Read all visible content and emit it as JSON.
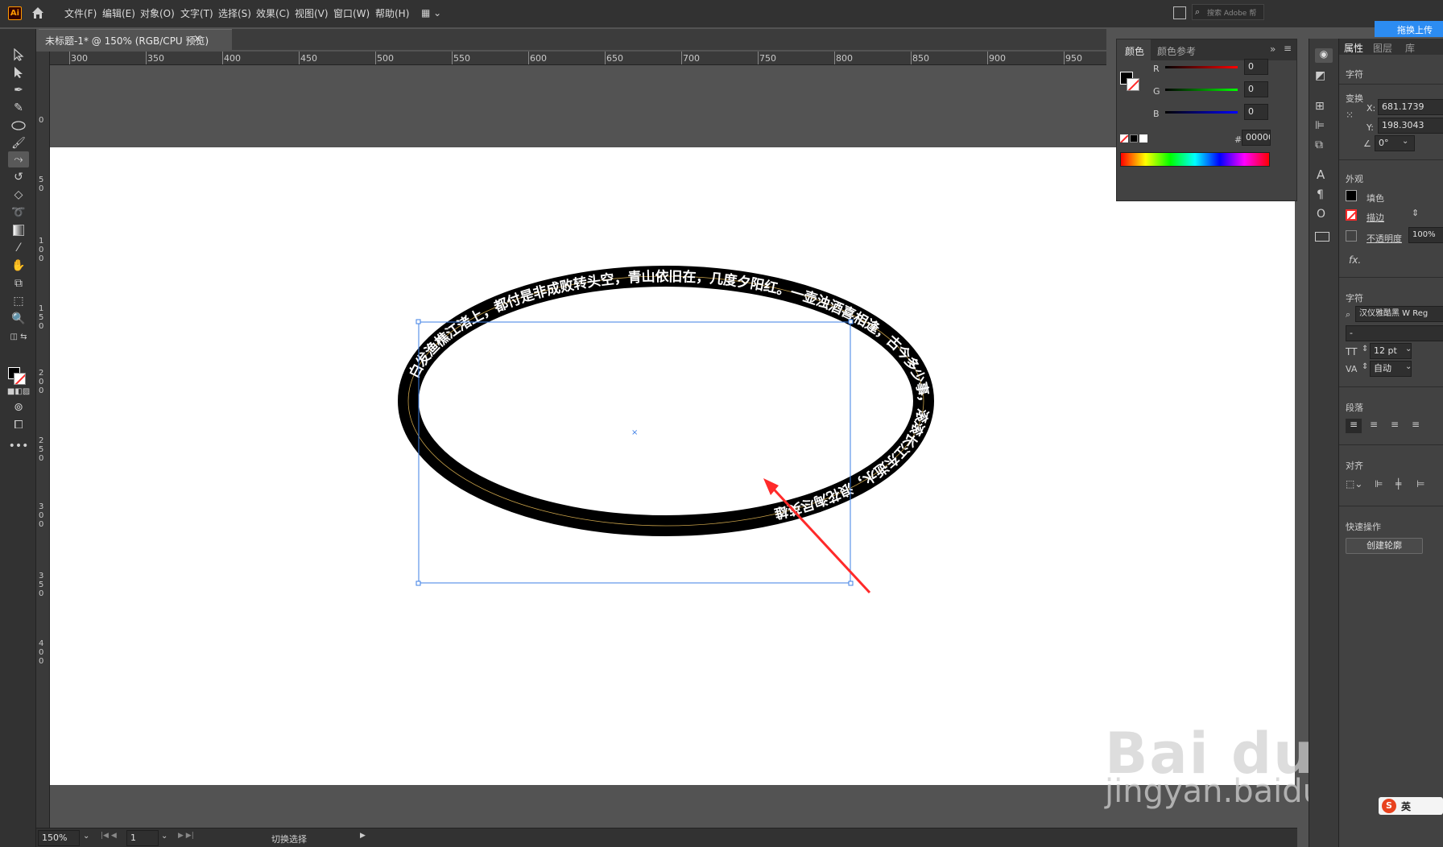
{
  "app": {
    "logo": "Ai",
    "home_icon": "home-icon"
  },
  "menu": [
    "文件(F)",
    "编辑(E)",
    "对象(O)",
    "文字(T)",
    "选择(S)",
    "效果(C)",
    "视图(V)",
    "窗口(W)",
    "帮助(H)"
  ],
  "search": {
    "placeholder": "搜索 Adobe 帮"
  },
  "document": {
    "tab_title": "未标题-1* @ 150% (RGB/CPU 预览)",
    "close": "×"
  },
  "ruler_top": [
    "300",
    "350",
    "400",
    "450",
    "500",
    "550",
    "600",
    "650",
    "700",
    "750",
    "800",
    "850",
    "900",
    "950"
  ],
  "ruler_left": [
    "0",
    "5\n0",
    "1\n0\n0",
    "1\n5\n0",
    "2\n0\n0",
    "2\n5\n0",
    "3\n0\n0",
    "3\n5\n0",
    "4\n0\n0"
  ],
  "color_panel": {
    "tab_color": "颜色",
    "tab_guide": "颜色参考",
    "r_label": "R",
    "r_value": "0",
    "g_label": "G",
    "g_value": "0",
    "b_label": "B",
    "b_value": "0",
    "hex_prefix": "#",
    "hex_value": "000000"
  },
  "props": {
    "tab_properties": "属性",
    "tab_layers": "图层",
    "tab_libraries": "库",
    "cloud_button": "拖换上传",
    "section_char": "字符",
    "section_transform": "变换",
    "x_label": "X:",
    "x_value": "681.1739",
    "y_label": "Y:",
    "y_value": "198.3043",
    "angle_value": "0°",
    "section_appearance": "外观",
    "fill_label": "填色",
    "stroke_label": "描边",
    "opacity_label": "不透明度",
    "opacity_value": "100%",
    "fx_label": "fx.",
    "section_character": "字符",
    "font_name": "汉仪雅酷黑 W Reg",
    "font_style": "-",
    "font_size": "12 pt",
    "tracking": "自动",
    "section_paragraph": "段落",
    "section_align": "对齐",
    "section_quick": "快速操作",
    "create_outline": "创建轮廓"
  },
  "artwork": {
    "ring_text": "白发渔樵江渚上，都付是非成败转头空，青山依旧在，几度夕阳红。一壶浊酒喜相逢，古今多少事，滚滚长江东逝水，浪花淘尽英雄"
  },
  "status": {
    "zoom": "150%",
    "page": "1",
    "hint": "切换选择"
  },
  "watermark": {
    "logo": "Bai du 经验",
    "url": "jingyan.baidu.com"
  },
  "ime": {
    "label": "英"
  },
  "colors": {
    "accent_red": "#ff2a2a",
    "selection_blue": "#3d7fe6"
  }
}
